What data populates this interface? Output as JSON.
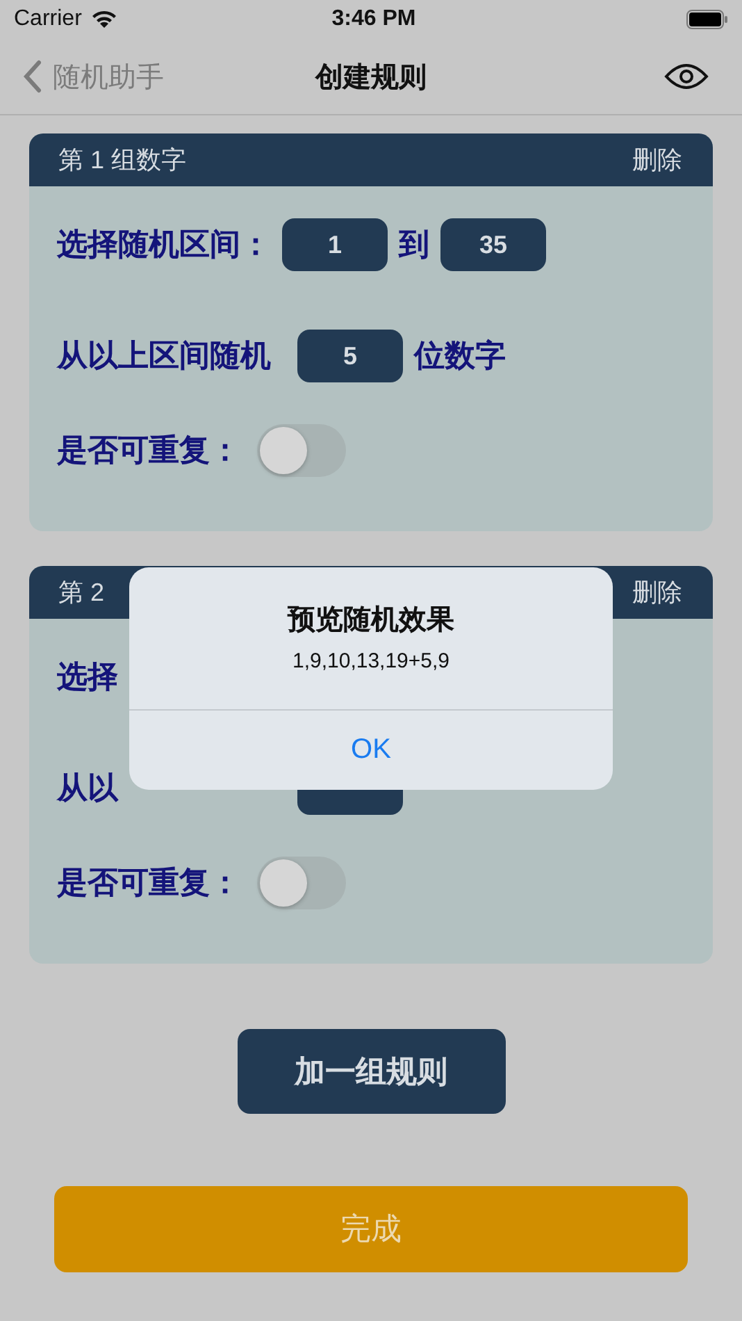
{
  "status_bar": {
    "carrier": "Carrier",
    "time": "3:46 PM"
  },
  "nav": {
    "back": "随机助手",
    "title": "创建规则"
  },
  "groups": [
    {
      "header": "第 1 组数字",
      "delete": "删除",
      "range_label": "选择随机区间：",
      "from": "1",
      "to_label": "到",
      "to": "35",
      "count_label": "从以上区间随机",
      "count": "5",
      "unit": "位数字",
      "repeat_label": "是否可重复：",
      "repeatable": false
    },
    {
      "header": "第 2",
      "delete": "删除",
      "range_label": "选择",
      "count_label": "从以",
      "repeat_label": "是否可重复：",
      "repeatable": false
    }
  ],
  "add_button": "加一组规则",
  "done_button": "完成",
  "alert": {
    "title": "预览随机效果",
    "message": "1,9,10,13,19+5,9",
    "button": "OK"
  }
}
